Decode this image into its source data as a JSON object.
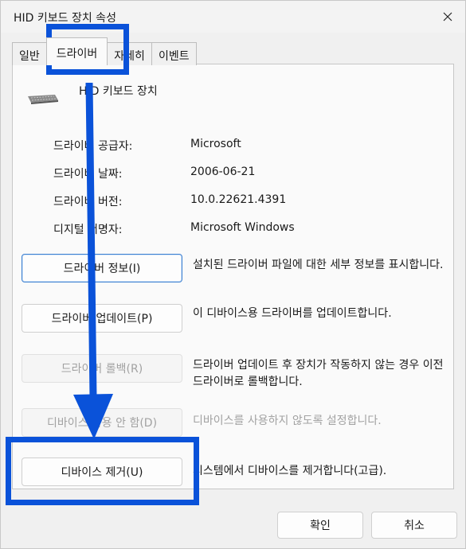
{
  "window": {
    "title": "HID 키보드 장치 속성"
  },
  "tabs": [
    {
      "label": "일반"
    },
    {
      "label": "드라이버"
    },
    {
      "label": "자세히"
    },
    {
      "label": "이벤트"
    }
  ],
  "device": {
    "name": "HID 키보드 장치",
    "icon": "keyboard-icon"
  },
  "info": [
    {
      "label": "드라이버 공급자:",
      "value": "Microsoft"
    },
    {
      "label": "드라이버 날짜:",
      "value": "2006-06-21"
    },
    {
      "label": "드라이버 버전:",
      "value": "10.0.22621.4391"
    },
    {
      "label": "디지털 서명자:",
      "value": "Microsoft Windows"
    }
  ],
  "actions": [
    {
      "label": "드라이버 정보(I)",
      "desc": "설치된 드라이버 파일에 대한 세부 정보를 표시합니다.",
      "enabled": true
    },
    {
      "label": "드라이버 업데이트(P)",
      "desc": "이 디바이스용 드라이버를 업데이트합니다.",
      "enabled": true
    },
    {
      "label": "드라이버 롤백(R)",
      "desc": "드라이버 업데이트 후 장치가 작동하지 않는 경우 이전 드라이버로 롤백합니다.",
      "enabled": false
    },
    {
      "label": "디바이스 사용 안 함(D)",
      "desc": "디바이스를 사용하지 않도록 설정합니다.",
      "enabled": false
    },
    {
      "label": "디바이스 제거(U)",
      "desc": "시스템에서 디바이스를 제거합니다(고급).",
      "enabled": true
    }
  ],
  "footer": {
    "ok_label": "확인",
    "cancel_label": "취소"
  },
  "annotation": {
    "color": "#0a52d9"
  }
}
